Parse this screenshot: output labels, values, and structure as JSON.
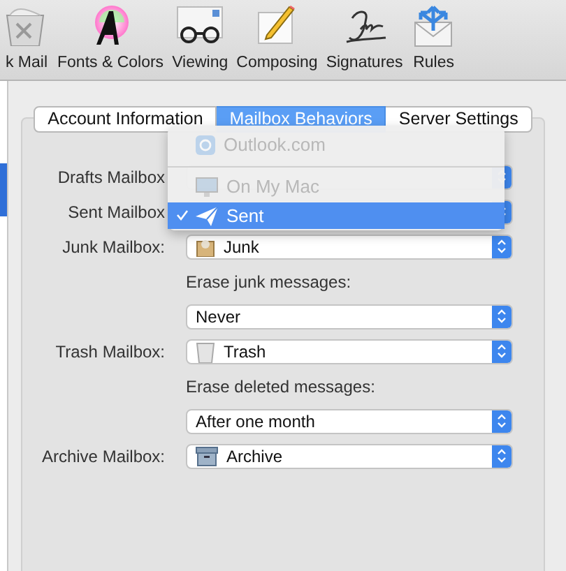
{
  "toolbar": {
    "items": [
      {
        "label": "k Mail",
        "kind": "junk"
      },
      {
        "label": "Fonts & Colors",
        "kind": "fonts"
      },
      {
        "label": "Viewing",
        "kind": "viewing"
      },
      {
        "label": "Composing",
        "kind": "composing"
      },
      {
        "label": "Signatures",
        "kind": "signatures"
      },
      {
        "label": "Rules",
        "kind": "rules"
      }
    ]
  },
  "tabs": [
    {
      "label": "Account Information",
      "selected": false
    },
    {
      "label": "Mailbox Behaviors",
      "selected": true
    },
    {
      "label": "Server Settings",
      "selected": false
    }
  ],
  "form": [
    {
      "kind": "popup",
      "label": "Drafts Mailbox"
    },
    {
      "kind": "popup",
      "label": "Sent Mailbox"
    },
    {
      "kind": "popup",
      "label": "Junk Mailbox:",
      "value": "Junk"
    },
    {
      "kind": "caption",
      "text": "Erase junk messages:"
    },
    {
      "kind": "popup",
      "value": "Never"
    },
    {
      "kind": "popup",
      "label": "Trash Mailbox:",
      "value": "Trash"
    },
    {
      "kind": "caption",
      "text": "Erase deleted messages:"
    },
    {
      "kind": "popup",
      "value": "After one month"
    },
    {
      "kind": "popup",
      "label": "Archive Mailbox:",
      "value": "Archive"
    }
  ],
  "menu": {
    "items": [
      {
        "kind": "item",
        "label": "Outlook.com",
        "disabled": true,
        "checked": false,
        "selected": false
      },
      {
        "kind": "separator"
      },
      {
        "kind": "item",
        "label": "On My Mac",
        "disabled": true,
        "checked": false,
        "selected": false
      },
      {
        "kind": "item",
        "label": "Sent",
        "disabled": false,
        "checked": true,
        "selected": true
      }
    ]
  }
}
